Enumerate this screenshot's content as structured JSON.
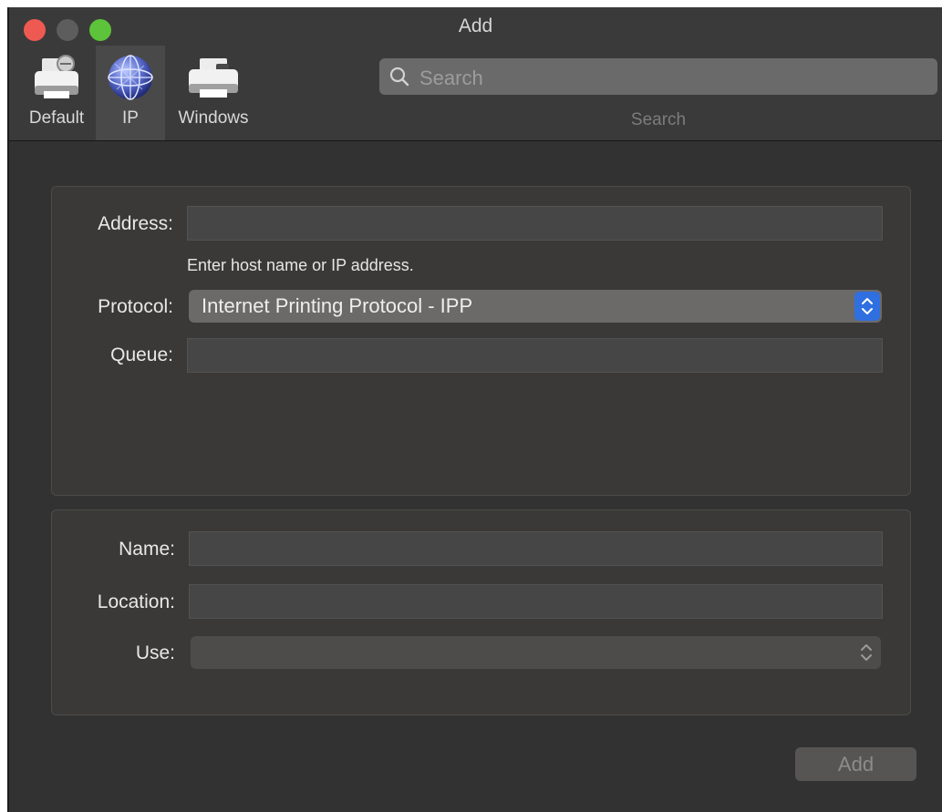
{
  "window": {
    "title": "Add"
  },
  "toolbar": {
    "items": [
      {
        "label": "Default",
        "icon": "printer-default-icon"
      },
      {
        "label": "IP",
        "icon": "globe-icon",
        "selected": true
      },
      {
        "label": "Windows",
        "icon": "printer-windows-icon"
      }
    ],
    "search": {
      "placeholder": "Search",
      "value": "",
      "caption": "Search"
    }
  },
  "connection": {
    "address_label": "Address:",
    "address_value": "",
    "address_hint": "Enter host name or IP address.",
    "protocol_label": "Protocol:",
    "protocol_value": "Internet Printing Protocol - IPP",
    "queue_label": "Queue:",
    "queue_value": ""
  },
  "details": {
    "name_label": "Name:",
    "name_value": "",
    "location_label": "Location:",
    "location_value": "",
    "use_label": "Use:",
    "use_value": ""
  },
  "actions": {
    "add_label": "Add"
  },
  "colors": {
    "close": "#ee5a52",
    "minimize": "#5d5d5d",
    "maximize": "#5cc33a",
    "accent": "#2f6fe0"
  }
}
